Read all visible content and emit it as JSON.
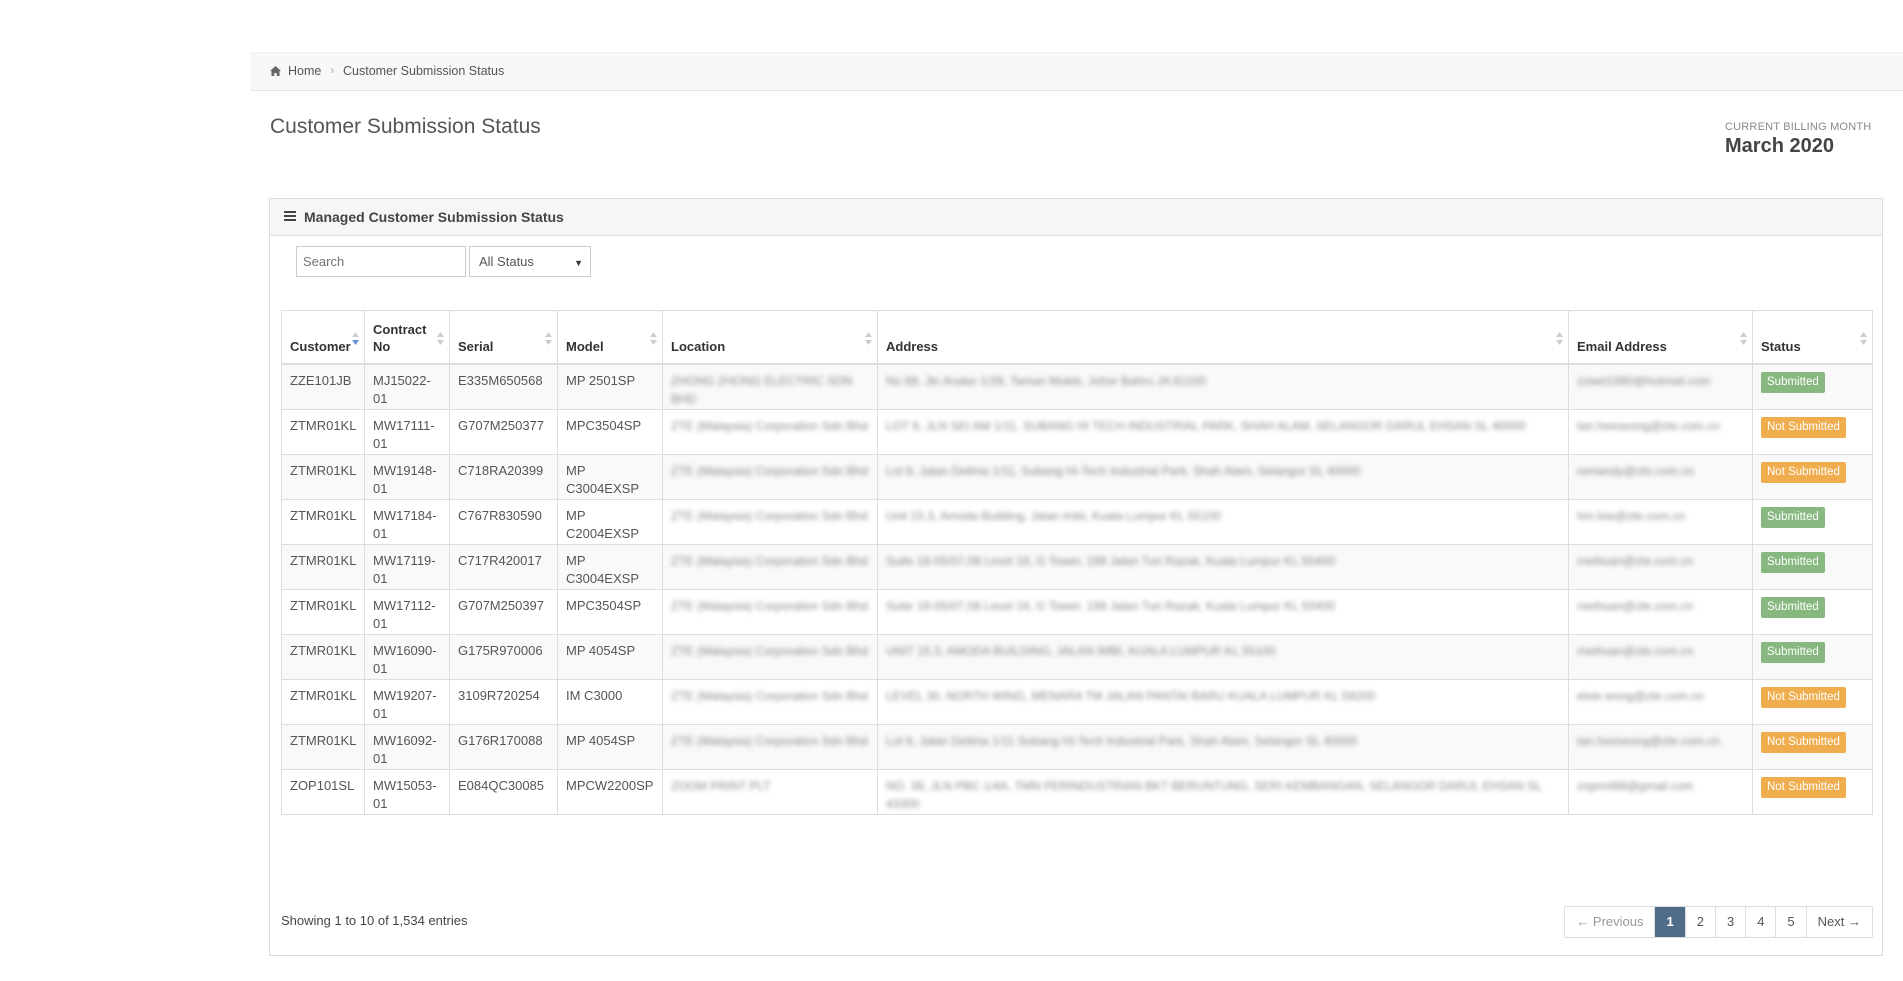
{
  "breadcrumb": {
    "home": "Home",
    "current": "Customer Submission Status"
  },
  "page_title": "Customer Submission Status",
  "billing": {
    "label": "CURRENT BILLING MONTH",
    "value": "March 2020"
  },
  "panel": {
    "title": "Managed Customer Submission Status",
    "search_placeholder": "Search",
    "status_filter": "All Status"
  },
  "table": {
    "columns": [
      "Customer",
      "Contract No",
      "Serial",
      "Model",
      "Location",
      "Address",
      "Email Address",
      "Status"
    ],
    "rows": [
      {
        "customer": "ZZE101JB",
        "contract": "MJ15022-01",
        "serial": "E335M650568",
        "model": "MP 2501SP",
        "location": "ZHONG ZHONG ELECTRIC SDN BHD",
        "address": "No 88, Jln Anake 1/28, Taman Molek, Johor Bahru JA 81100",
        "email": "zzwel1980@hotmail.com",
        "status": "Submitted"
      },
      {
        "customer": "ZTMR01KL",
        "contract": "MW17111-01",
        "serial": "G707M250377",
        "model": "MPC3504SP",
        "location": "ZTE (Malaysia) Corporation Sdn Bhd",
        "address": "LOT 6, JLN SEI AM 1/11, SUBANG HI TECH INDUSTRIAL PARK, SHAH ALAM, SELANGOR DARUL EHSAN SL 40000",
        "email": "tan.heeseong@zte.com.cn",
        "status": "Not Submitted"
      },
      {
        "customer": "ZTMR01KL",
        "contract": "MW19148-01",
        "serial": "C718RA20399",
        "model": "MP C3004EXSP",
        "location": "ZTE (Malaysia) Corporation Sdn Bhd",
        "address": "Lot 6, Jalan Delima 1/11, Subang Hi-Tech Industrial Park, Shah Alam, Selangor SL 40000",
        "email": "remandy@zte.com.cn",
        "status": "Not Submitted"
      },
      {
        "customer": "ZTMR01KL",
        "contract": "MW17184-01",
        "serial": "C767R830590",
        "model": "MP C2004EXSP",
        "location": "ZTE (Malaysia) Corporation Sdn Bhd",
        "address": "Unit 15.3, Amoda Building, Jalan Imbi, Kuala Lumpur KL 55100",
        "email": "hm.low@zte.com.cn",
        "status": "Submitted"
      },
      {
        "customer": "ZTMR01KL",
        "contract": "MW17119-01",
        "serial": "C717R420017",
        "model": "MP C3004EXSP",
        "location": "ZTE (Malaysia) Corporation Sdn Bhd",
        "address": "Suite 18-05/07,08 Level 18, G Tower, 199 Jalan Tun Razak, Kuala Lumpur KL 50400",
        "email": "meihuan@zte.com.cn",
        "status": "Submitted"
      },
      {
        "customer": "ZTMR01KL",
        "contract": "MW17112-01",
        "serial": "G707M250397",
        "model": "MPC3504SP",
        "location": "ZTE (Malaysia) Corporation Sdn Bhd",
        "address": "Suite 18-05/07,08 Level 18, G Tower, 199 Jalan Tun Razak, Kuala Lumpur KL 50400",
        "email": "meihuan@zte.com.cn",
        "status": "Submitted"
      },
      {
        "customer": "ZTMR01KL",
        "contract": "MW16090-01",
        "serial": "G175R970006",
        "model": "MP 4054SP",
        "location": "ZTE (Malaysia) Corporation Sdn Bhd",
        "address": "UNIT 15.3, AMODA BUILDING, JALAN IMBI, KUALA LUMPUR KL 55100",
        "email": "meihuan@zte.com.cn",
        "status": "Submitted"
      },
      {
        "customer": "ZTMR01KL",
        "contract": "MW19207-01",
        "serial": "3109R720254",
        "model": "IM C3000",
        "location": "ZTE (Malaysia) Corporation Sdn Bhd",
        "address": "LEVEL 30, NORTH WING, MENARA TM JALAN PANTAI BARU KUALA LUMPUR KL 59200",
        "email": "elsie.wong@zte.com.cn",
        "status": "Not Submitted"
      },
      {
        "customer": "ZTMR01KL",
        "contract": "MW16092-01",
        "serial": "G176R170088",
        "model": "MP 4054SP",
        "location": "ZTE (Malaysia) Corporation Sdn Bhd",
        "address": "Lot 6, Jalan Delima 1/11 Subang Hi-Tech Industrial Park, Shah Alam, Selangor SL 40000",
        "email": "tan.heeseong@zte.com.cn",
        "status": "Not Submitted"
      },
      {
        "customer": "ZOP101SL",
        "contract": "MW15053-01",
        "serial": "E084QC30085",
        "model": "MPCW2200SP",
        "location": "ZOOM PRINT PLT",
        "address": "NO. 36, JLN PBC 1/4A, TMN PERINDUSTRIAN BKT BERUNTUNG, SERI KEMBANGAN, SELANGOR DARUL EHSAN SL 43300",
        "email": "zoprint88@gmail.com",
        "status": "Not Submitted"
      }
    ]
  },
  "footer": {
    "info": "Showing 1 to 10 of 1,534 entries",
    "pages": [
      "← Previous",
      "1",
      "2",
      "3",
      "4",
      "5",
      "Next →"
    ],
    "active_page": "1"
  },
  "colors": {
    "submitted": "#87b87f",
    "not_submitted": "#f0ad4e",
    "active_page": "#4f6c8a"
  }
}
